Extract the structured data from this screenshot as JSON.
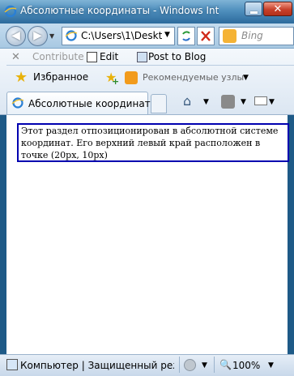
{
  "window": {
    "title": "Абсолютные координаты - Windows Inte",
    "close_glyph": "✕",
    "min_glyph": ""
  },
  "nav": {
    "back_glyph": "◀",
    "forward_glyph": "▶",
    "address": "C:\\Users\\1\\Deskt",
    "search_placeholder": "Bing",
    "dropdown_glyph": "▼"
  },
  "commandbar": {
    "contribute": "Contribute",
    "edit": "Edit",
    "post_to_blog": "Post to Blog",
    "x_glyph": "✕"
  },
  "favorites": {
    "label": "Избранное",
    "suggested_sites": "Рекомендуемые узлы",
    "star_glyph": "★",
    "plus_glyph": "+"
  },
  "tab": {
    "label": "Абсолютные координаты"
  },
  "toolbar_icons": {
    "home_glyph": "⌂"
  },
  "content": {
    "box_text": "Этот раздел отпозиционирован в абсолютной системе координат. Его верхний левый край расположен в точке (20px, 10px)"
  },
  "status": {
    "text": "Компьютер | Защищенный режим:",
    "zoom": "100%",
    "zoom_glyph": "🔍"
  },
  "colors": {
    "box_border": "#0000b0",
    "aero_frame": "#1e5a87"
  }
}
